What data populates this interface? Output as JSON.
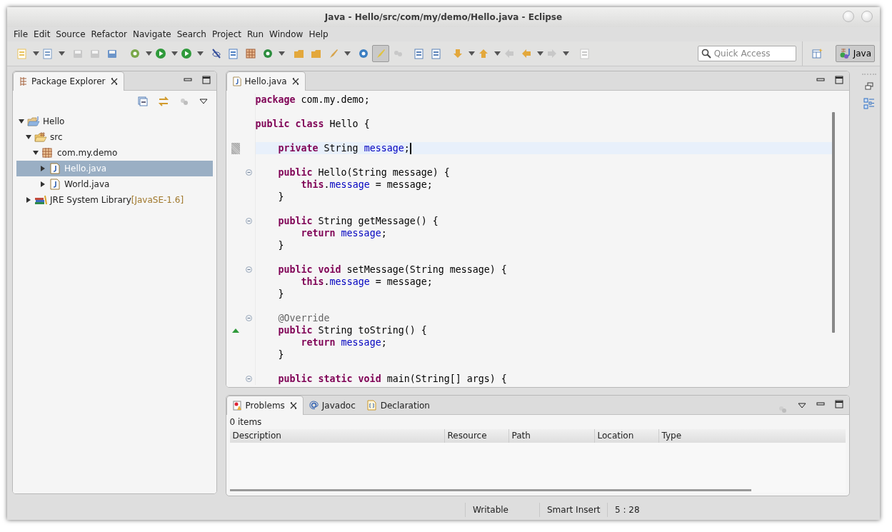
{
  "window": {
    "title": "Java - Hello/src/com/my/demo/Hello.java - Eclipse"
  },
  "menu": [
    "File",
    "Edit",
    "Source",
    "Refactor",
    "Navigate",
    "Search",
    "Project",
    "Run",
    "Window",
    "Help"
  ],
  "quick_access": {
    "placeholder": "Quick Access"
  },
  "perspective": {
    "label": "Java",
    "selected": true
  },
  "package_explorer": {
    "tab": {
      "label": "Package Explorer",
      "selected": true
    },
    "tree": [
      {
        "label": "Hello",
        "kind": "project",
        "expanded": true,
        "selected": false,
        "children": [
          {
            "label": "src",
            "kind": "source-folder",
            "expanded": true,
            "selected": false,
            "children": [
              {
                "label": "com.my.demo",
                "kind": "package",
                "expanded": true,
                "selected": false,
                "children": [
                  {
                    "label": "Hello.java",
                    "kind": "java-file",
                    "expanded": false,
                    "selected": true
                  },
                  {
                    "label": "World.java",
                    "kind": "java-file",
                    "expanded": false,
                    "selected": false
                  }
                ]
              }
            ]
          },
          {
            "label": "JRE System Library",
            "suffix": "[JavaSE-1.6]",
            "kind": "library",
            "expanded": false,
            "selected": false
          }
        ]
      }
    ]
  },
  "editor": {
    "tabs": [
      {
        "label": "Hello.java",
        "selected": true
      }
    ],
    "lines": [
      {
        "tokens": [
          {
            "text": "package",
            "kind": "keyword"
          },
          {
            "text": " com.my.demo;",
            "kind": "plain"
          }
        ]
      },
      {
        "blank_before": true,
        "tokens": [
          {
            "text": "public class",
            "kind": "keyword"
          },
          {
            "text": " Hello {",
            "kind": "plain"
          }
        ]
      },
      {
        "blank_before": true,
        "current": true,
        "occurrence": true,
        "tokens": [
          {
            "text": "    private",
            "kind": "keyword"
          },
          {
            "text": " String ",
            "kind": "plain"
          },
          {
            "text": "message",
            "kind": "field"
          },
          {
            "text": ";",
            "kind": "plain"
          }
        ]
      },
      {
        "blank_before": true,
        "foldable": true,
        "tokens": [
          {
            "text": "    public",
            "kind": "keyword"
          },
          {
            "text": " Hello(String message) {",
            "kind": "plain"
          }
        ]
      },
      {
        "tokens": [
          {
            "text": "        this",
            "kind": "keyword"
          },
          {
            "text": ".",
            "kind": "plain"
          },
          {
            "text": "message",
            "kind": "field"
          },
          {
            "text": " = message;",
            "kind": "plain"
          }
        ]
      },
      {
        "tokens": [
          {
            "text": "    }",
            "kind": "plain"
          }
        ]
      },
      {
        "blank_before": true,
        "foldable": true,
        "tokens": [
          {
            "text": "    public",
            "kind": "keyword"
          },
          {
            "text": " String getMessage() {",
            "kind": "plain"
          }
        ]
      },
      {
        "tokens": [
          {
            "text": "        return",
            "kind": "keyword"
          },
          {
            "text": " message",
            "kind": "field"
          },
          {
            "text": ";",
            "kind": "plain"
          }
        ]
      },
      {
        "tokens": [
          {
            "text": "    }",
            "kind": "plain"
          }
        ]
      },
      {
        "blank_before": true,
        "foldable": true,
        "tokens": [
          {
            "text": "    public void",
            "kind": "keyword"
          },
          {
            "text": " setMessage(String message) {",
            "kind": "plain"
          }
        ]
      },
      {
        "tokens": [
          {
            "text": "        this",
            "kind": "keyword"
          },
          {
            "text": ".",
            "kind": "plain"
          },
          {
            "text": "message",
            "kind": "field"
          },
          {
            "text": " = message;",
            "kind": "plain"
          }
        ]
      },
      {
        "tokens": [
          {
            "text": "    }",
            "kind": "plain"
          }
        ]
      },
      {
        "blank_before": true,
        "foldable": true,
        "tokens": [
          {
            "text": "    @Override",
            "kind": "annotation"
          }
        ]
      },
      {
        "overrides": true,
        "tokens": [
          {
            "text": "    public",
            "kind": "keyword"
          },
          {
            "text": " String toString() {",
            "kind": "plain"
          }
        ]
      },
      {
        "tokens": [
          {
            "text": "        return",
            "kind": "keyword"
          },
          {
            "text": " message",
            "kind": "field"
          },
          {
            "text": ";",
            "kind": "plain"
          }
        ]
      },
      {
        "tokens": [
          {
            "text": "    }",
            "kind": "plain"
          }
        ]
      },
      {
        "blank_before": true,
        "foldable": true,
        "tokens": [
          {
            "text": "    public static void",
            "kind": "keyword"
          },
          {
            "text": " main(String[] args) {",
            "kind": "plain"
          }
        ]
      }
    ]
  },
  "bottom_panel": {
    "tabs": [
      {
        "label": "Problems",
        "selected": true,
        "kind": "problems"
      },
      {
        "label": "Javadoc",
        "selected": false,
        "kind": "javadoc"
      },
      {
        "label": "Declaration",
        "selected": false,
        "kind": "declaration"
      }
    ],
    "summary": "0 items",
    "columns": [
      "Description",
      "Resource",
      "Path",
      "Location",
      "Type"
    ]
  },
  "status_bar": [
    "Writable",
    "Smart Insert",
    "5 : 28"
  ]
}
